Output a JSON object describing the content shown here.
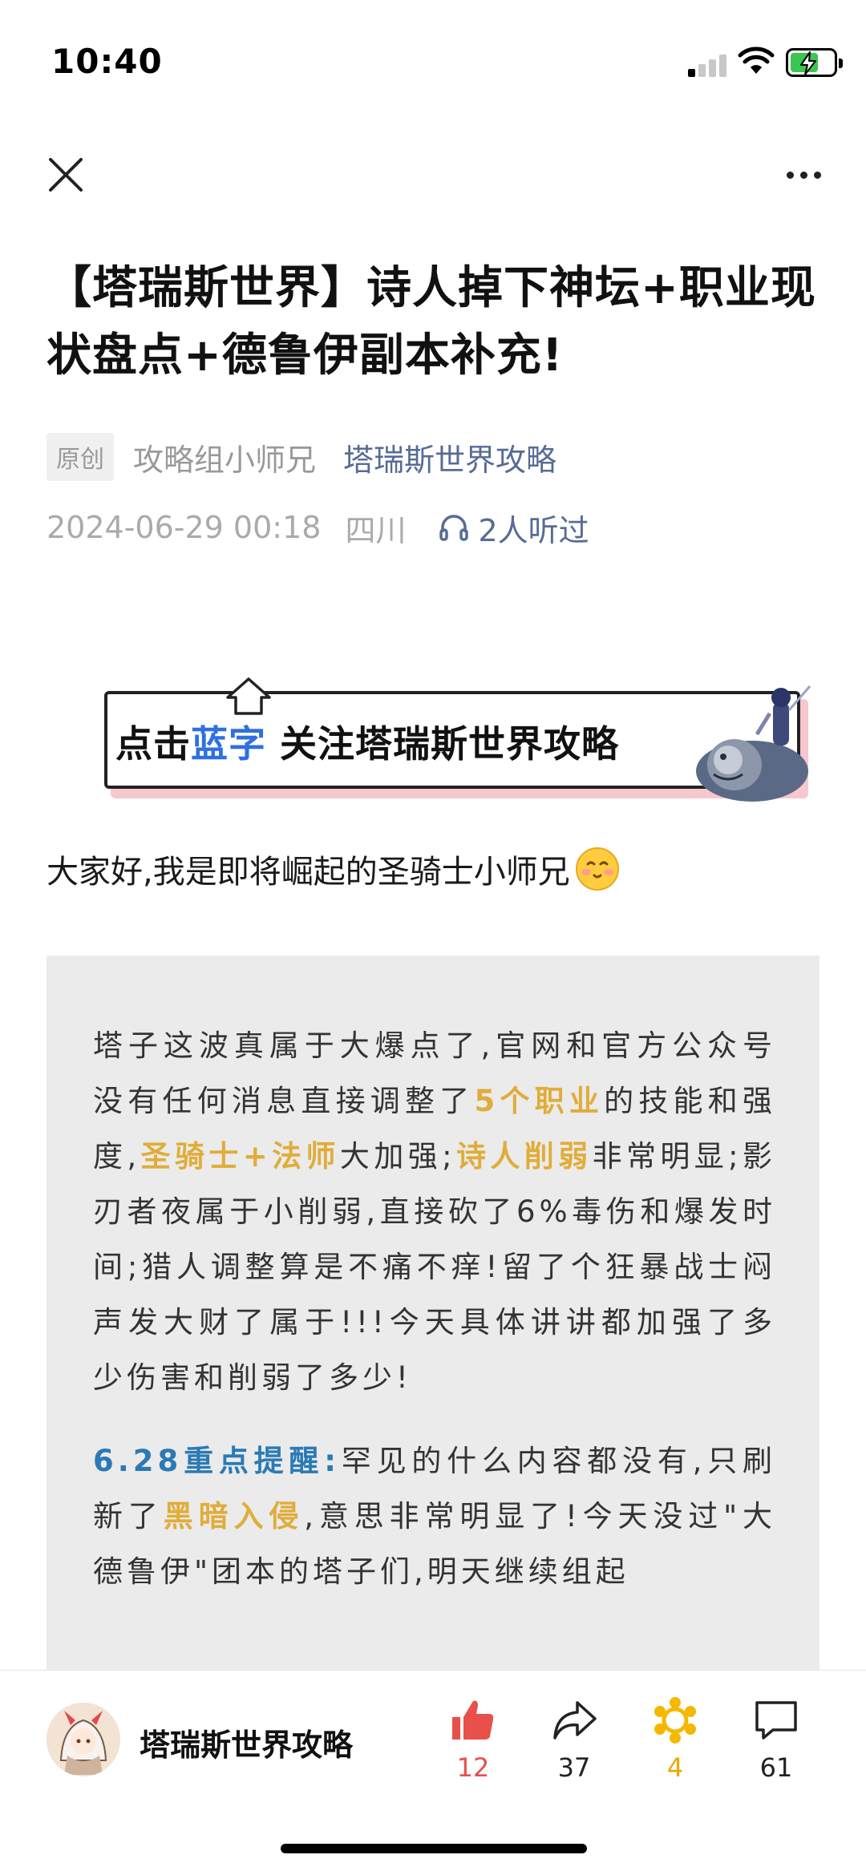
{
  "status_bar": {
    "time": "10:40"
  },
  "article": {
    "title": "【塔瑞斯世界】诗人掉下神坛+职业现状盘点+德鲁伊副本补充!",
    "original_badge": "原创",
    "author": "攻略组小师兄",
    "account_link": "塔瑞斯世界攻略",
    "datetime": "2024-06-29 00:18",
    "location": "四川",
    "listen_count": "2人听过"
  },
  "banner": {
    "prefix": "点击",
    "blue_text": "蓝字",
    "suffix": " 关注塔瑞斯世界攻略"
  },
  "greeting": "大家好,我是即将崛起的圣骑士小师兄",
  "quote": {
    "p1": [
      "塔子这波真属于大爆点了,官网和官方公众号没有任何消息直接调整了",
      "5个职业",
      "的技能和强度,",
      "圣骑士+法师",
      "大加强;",
      "诗人削弱",
      "非常明显;影刃者夜属于小削弱,直接砍了6%毒伤和爆发时间;猎人调整算是不痛不痒!留了个狂暴战士闷声发大财了属于!!!今天具体讲讲都加强了多少伤害和削弱了多少!"
    ],
    "p2": [
      "6.28重点提醒:",
      "罕见的什么内容都没有,只刷新了",
      "黑暗入侵",
      ",意思非常明显了!今天没过\"大德鲁伊\"团本的塔子们,明天继续组起"
    ]
  },
  "bottom_bar": {
    "account_name": "塔瑞斯世界攻略",
    "like_count": "12",
    "share_count": "37",
    "wow_count": "4",
    "comment_count": "61"
  },
  "colors": {
    "link_blue": "#576b95",
    "highlight_gold": "#e0ad3a",
    "highlight_blue": "#2b7ab5",
    "like_red": "#e8504a",
    "wow_yellow": "#e8a800"
  }
}
